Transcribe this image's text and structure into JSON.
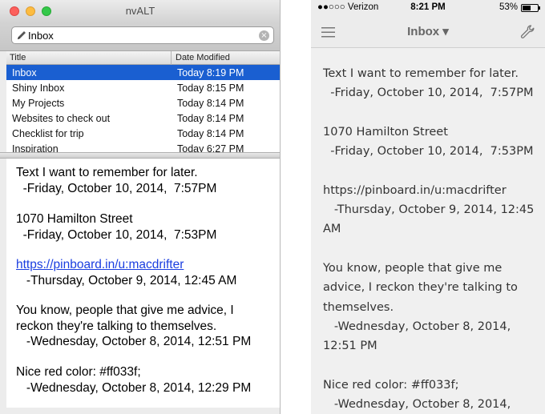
{
  "mac": {
    "window_title": "nvALT",
    "search_value": "Inbox",
    "columns": {
      "title": "Title",
      "date": "Date Modified"
    },
    "notes": [
      {
        "title": "Inbox",
        "date": "Today  8:19 PM"
      },
      {
        "title": "Shiny Inbox",
        "date": "Today  8:15 PM"
      },
      {
        "title": "My Projects",
        "date": "Today  8:14 PM"
      },
      {
        "title": "Websites to check out",
        "date": "Today  8:14 PM"
      },
      {
        "title": "Checklist for trip",
        "date": "Today  8:14 PM"
      },
      {
        "title": "Inspiration",
        "date": "Today  6:27 PM"
      }
    ],
    "body": {
      "p1": "Text I want to remember for later.\n  -Friday, October 10, 2014,  7:57PM",
      "p2": "1070 Hamilton Street\n  -Friday, October 10, 2014,  7:53PM",
      "p3_link": "https://pinboard.in/u:macdrifter",
      "p3_date": "   -Thursday, October 9, 2014, 12:45 AM",
      "p4": "You know, people that give me advice, I\nreckon they're talking to themselves.\n   -Wednesday, October 8, 2014, 12:51 PM",
      "p5": "Nice red color: #ff033f;\n   -Wednesday, October 8, 2014, 12:29 PM"
    },
    "colors": {
      "selection": "#1a5fd1",
      "link": "#1a3ee0"
    }
  },
  "phone": {
    "status": {
      "carrier": "●●○○○ Verizon",
      "time": "8:21 PM",
      "battery": "53%",
      "battery_level": 0.53
    },
    "nav_title": "Inbox ▾",
    "body": {
      "p1": "Text I want to remember for later.\n  -Friday, October 10, 2014,  7:57PM",
      "p2": "1070 Hamilton Street\n  -Friday, October 10, 2014,  7:53PM",
      "p3": "https://pinboard.in/u:macdrifter\n   -Thursday, October 9, 2014, 12:45\nAM",
      "p4": "You know, people that give me\nadvice, I reckon they're talking to\nthemselves.\n   -Wednesday, October 8, 2014,\n12:51 PM",
      "p5": "Nice red color: #ff033f;\n   -Wednesday, October 8, 2014,"
    }
  }
}
